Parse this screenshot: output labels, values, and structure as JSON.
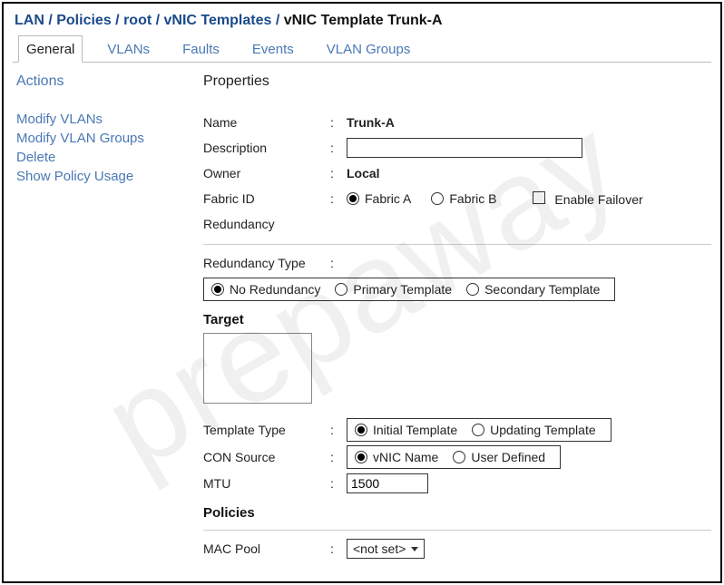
{
  "watermark": "prepaway",
  "breadcrumb": {
    "parts": [
      "LAN",
      "Policies",
      "root",
      "vNIC Templates"
    ],
    "current": "vNIC Template Trunk-A",
    "separator": " / "
  },
  "tabs": [
    {
      "label": "General",
      "active": true
    },
    {
      "label": "VLANs",
      "active": false
    },
    {
      "label": "Faults",
      "active": false
    },
    {
      "label": "Events",
      "active": false
    },
    {
      "label": "VLAN Groups",
      "active": false
    }
  ],
  "actions": {
    "header": "Actions",
    "items": [
      "Modify VLANs",
      "Modify VLAN Groups",
      "Delete",
      "Show Policy Usage"
    ]
  },
  "properties": {
    "header": "Properties",
    "name": {
      "label": "Name",
      "value": "Trunk-A"
    },
    "description": {
      "label": "Description",
      "value": ""
    },
    "owner": {
      "label": "Owner",
      "value": "Local"
    },
    "fabric_id": {
      "label": "Fabric ID",
      "options": [
        {
          "label": "Fabric A",
          "selected": true
        },
        {
          "label": "Fabric B",
          "selected": false
        }
      ],
      "failover": {
        "label": "Enable Failover",
        "checked": false
      }
    },
    "redundancy": {
      "header": "Redundancy",
      "type_label": "Redundancy Type",
      "options": [
        {
          "label": "No Redundancy",
          "selected": true
        },
        {
          "label": "Primary Template",
          "selected": false
        },
        {
          "label": "Secondary Template",
          "selected": false
        }
      ]
    },
    "target": {
      "header": "Target"
    },
    "template_type": {
      "label": "Template Type",
      "options": [
        {
          "label": "Initial Template",
          "selected": true
        },
        {
          "label": "Updating  Template",
          "selected": false
        }
      ]
    },
    "con_source": {
      "label": "CON Source",
      "options": [
        {
          "label": "vNIC Name",
          "selected": true
        },
        {
          "label": "User Defined",
          "selected": false
        }
      ]
    },
    "mtu": {
      "label": "MTU",
      "value": "1500"
    },
    "policies": {
      "header": "Policies",
      "mac_pool": {
        "label": "MAC Pool",
        "value": "<not set>"
      }
    }
  }
}
